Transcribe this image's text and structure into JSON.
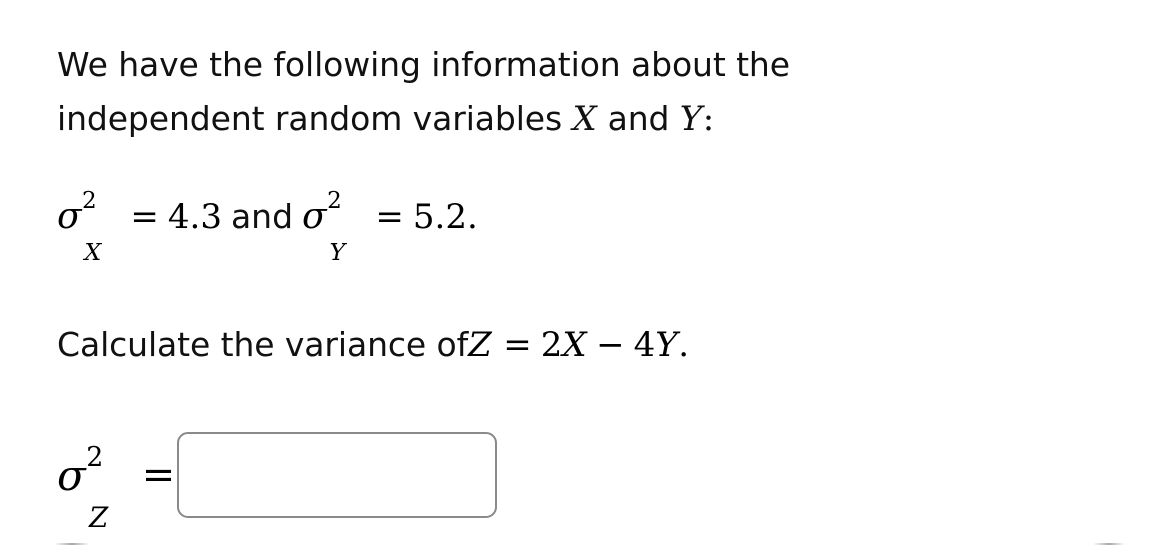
{
  "problem": {
    "statement_line_1": "We have the following information about the",
    "statement_line_2_prefix": "independent random variables ",
    "statement_var_x": "X",
    "statement_conjunction": " and ",
    "statement_var_y": "Y",
    "statement_line_2_suffix": ":"
  },
  "given": {
    "sigma_glyph": "σ",
    "exponent": "2",
    "subscript_x": "X",
    "equals": "=",
    "value_x": "4.3",
    "conjunction": "and",
    "subscript_y": "Y",
    "value_y": "5.2."
  },
  "task": {
    "text_prefix": "Calculate the variance of ",
    "var_z": "Z",
    "equals": "=",
    "coefficient_x": "2",
    "var_x": "X",
    "minus": "−",
    "coefficient_y": "4",
    "var_y": "Y",
    "period": "."
  },
  "answer": {
    "sigma_glyph": "σ",
    "exponent": "2",
    "subscript_z": "Z",
    "equals": "=",
    "input_value": "",
    "input_placeholder": ""
  },
  "style": {
    "background": "#ffffff",
    "text_color": "#111111",
    "input_border_color": "#8a8a8a"
  }
}
